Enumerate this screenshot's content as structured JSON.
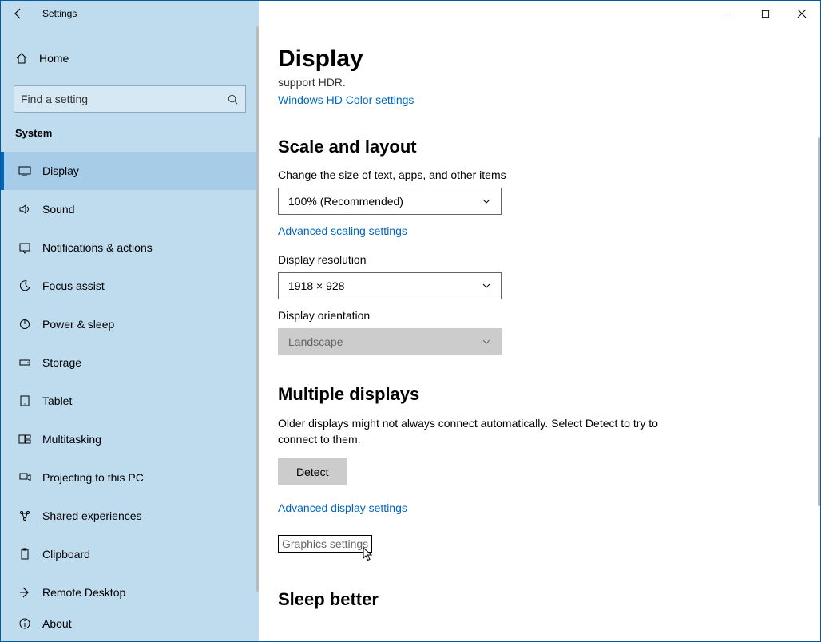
{
  "window": {
    "title": "Settings"
  },
  "sidebar": {
    "home": "Home",
    "search_placeholder": "Find a setting",
    "category": "System",
    "items": [
      {
        "label": "Display",
        "icon": "monitor",
        "active": true
      },
      {
        "label": "Sound",
        "icon": "sound"
      },
      {
        "label": "Notifications & actions",
        "icon": "notification"
      },
      {
        "label": "Focus assist",
        "icon": "moon"
      },
      {
        "label": "Power & sleep",
        "icon": "power"
      },
      {
        "label": "Storage",
        "icon": "storage"
      },
      {
        "label": "Tablet",
        "icon": "tablet"
      },
      {
        "label": "Multitasking",
        "icon": "multitask"
      },
      {
        "label": "Projecting to this PC",
        "icon": "project"
      },
      {
        "label": "Shared experiences",
        "icon": "shared"
      },
      {
        "label": "Clipboard",
        "icon": "clipboard"
      },
      {
        "label": "Remote Desktop",
        "icon": "remote"
      },
      {
        "label": "About",
        "icon": "about"
      }
    ]
  },
  "main": {
    "page_title": "Display",
    "hdr_note": "support HDR.",
    "hdr_link": "Windows HD Color settings",
    "scale_heading": "Scale and layout",
    "scale_label": "Change the size of text, apps, and other items",
    "scale_value": "100% (Recommended)",
    "scale_link": "Advanced scaling settings",
    "resolution_label": "Display resolution",
    "resolution_value": "1918 × 928",
    "orientation_label": "Display orientation",
    "orientation_value": "Landscape",
    "multi_heading": "Multiple displays",
    "multi_text": "Older displays might not always connect automatically. Select Detect to try to connect to them.",
    "detect_btn": "Detect",
    "adv_display_link": "Advanced display settings",
    "graphics_link": "Graphics settings",
    "sleep_heading": "Sleep better"
  }
}
